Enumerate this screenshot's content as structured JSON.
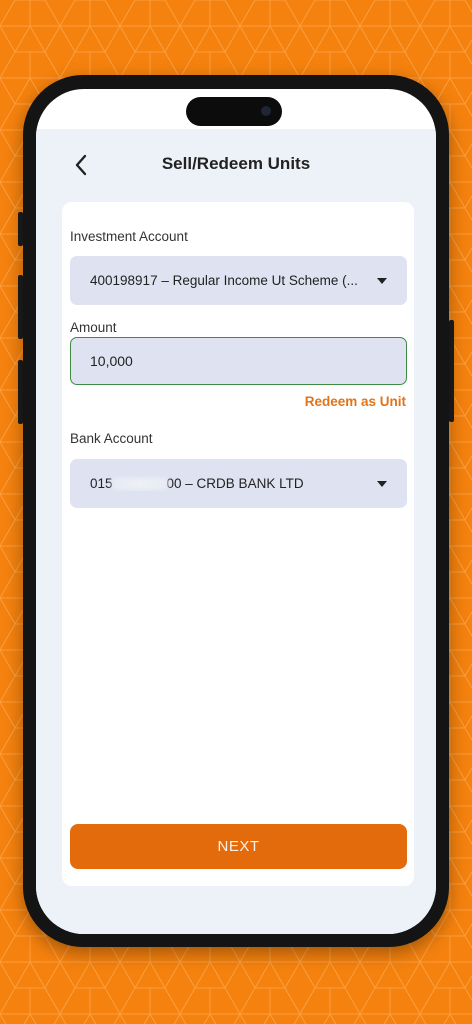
{
  "colors": {
    "background": "#F5820E",
    "accent": "#E36B0C",
    "link": "#E0741B",
    "input_fill": "#DFE3F1",
    "input_border_active": "#3E8C43"
  },
  "header": {
    "back_icon": "chevron-left-icon",
    "title": "Sell/Redeem Units"
  },
  "form": {
    "investment_account": {
      "label": "Investment Account",
      "value": "400198917 – Regular Income Ut Scheme (...",
      "icon": "caret-down-icon"
    },
    "amount": {
      "label": "Amount",
      "value": "10,000"
    },
    "redeem_as_unit_label": "Redeem as Unit",
    "bank_account": {
      "label": "Bank Account",
      "value_prefix": "015",
      "value_suffix": "00 – CRDB BANK LTD",
      "icon": "caret-down-icon"
    }
  },
  "actions": {
    "next_label": "NEXT"
  }
}
